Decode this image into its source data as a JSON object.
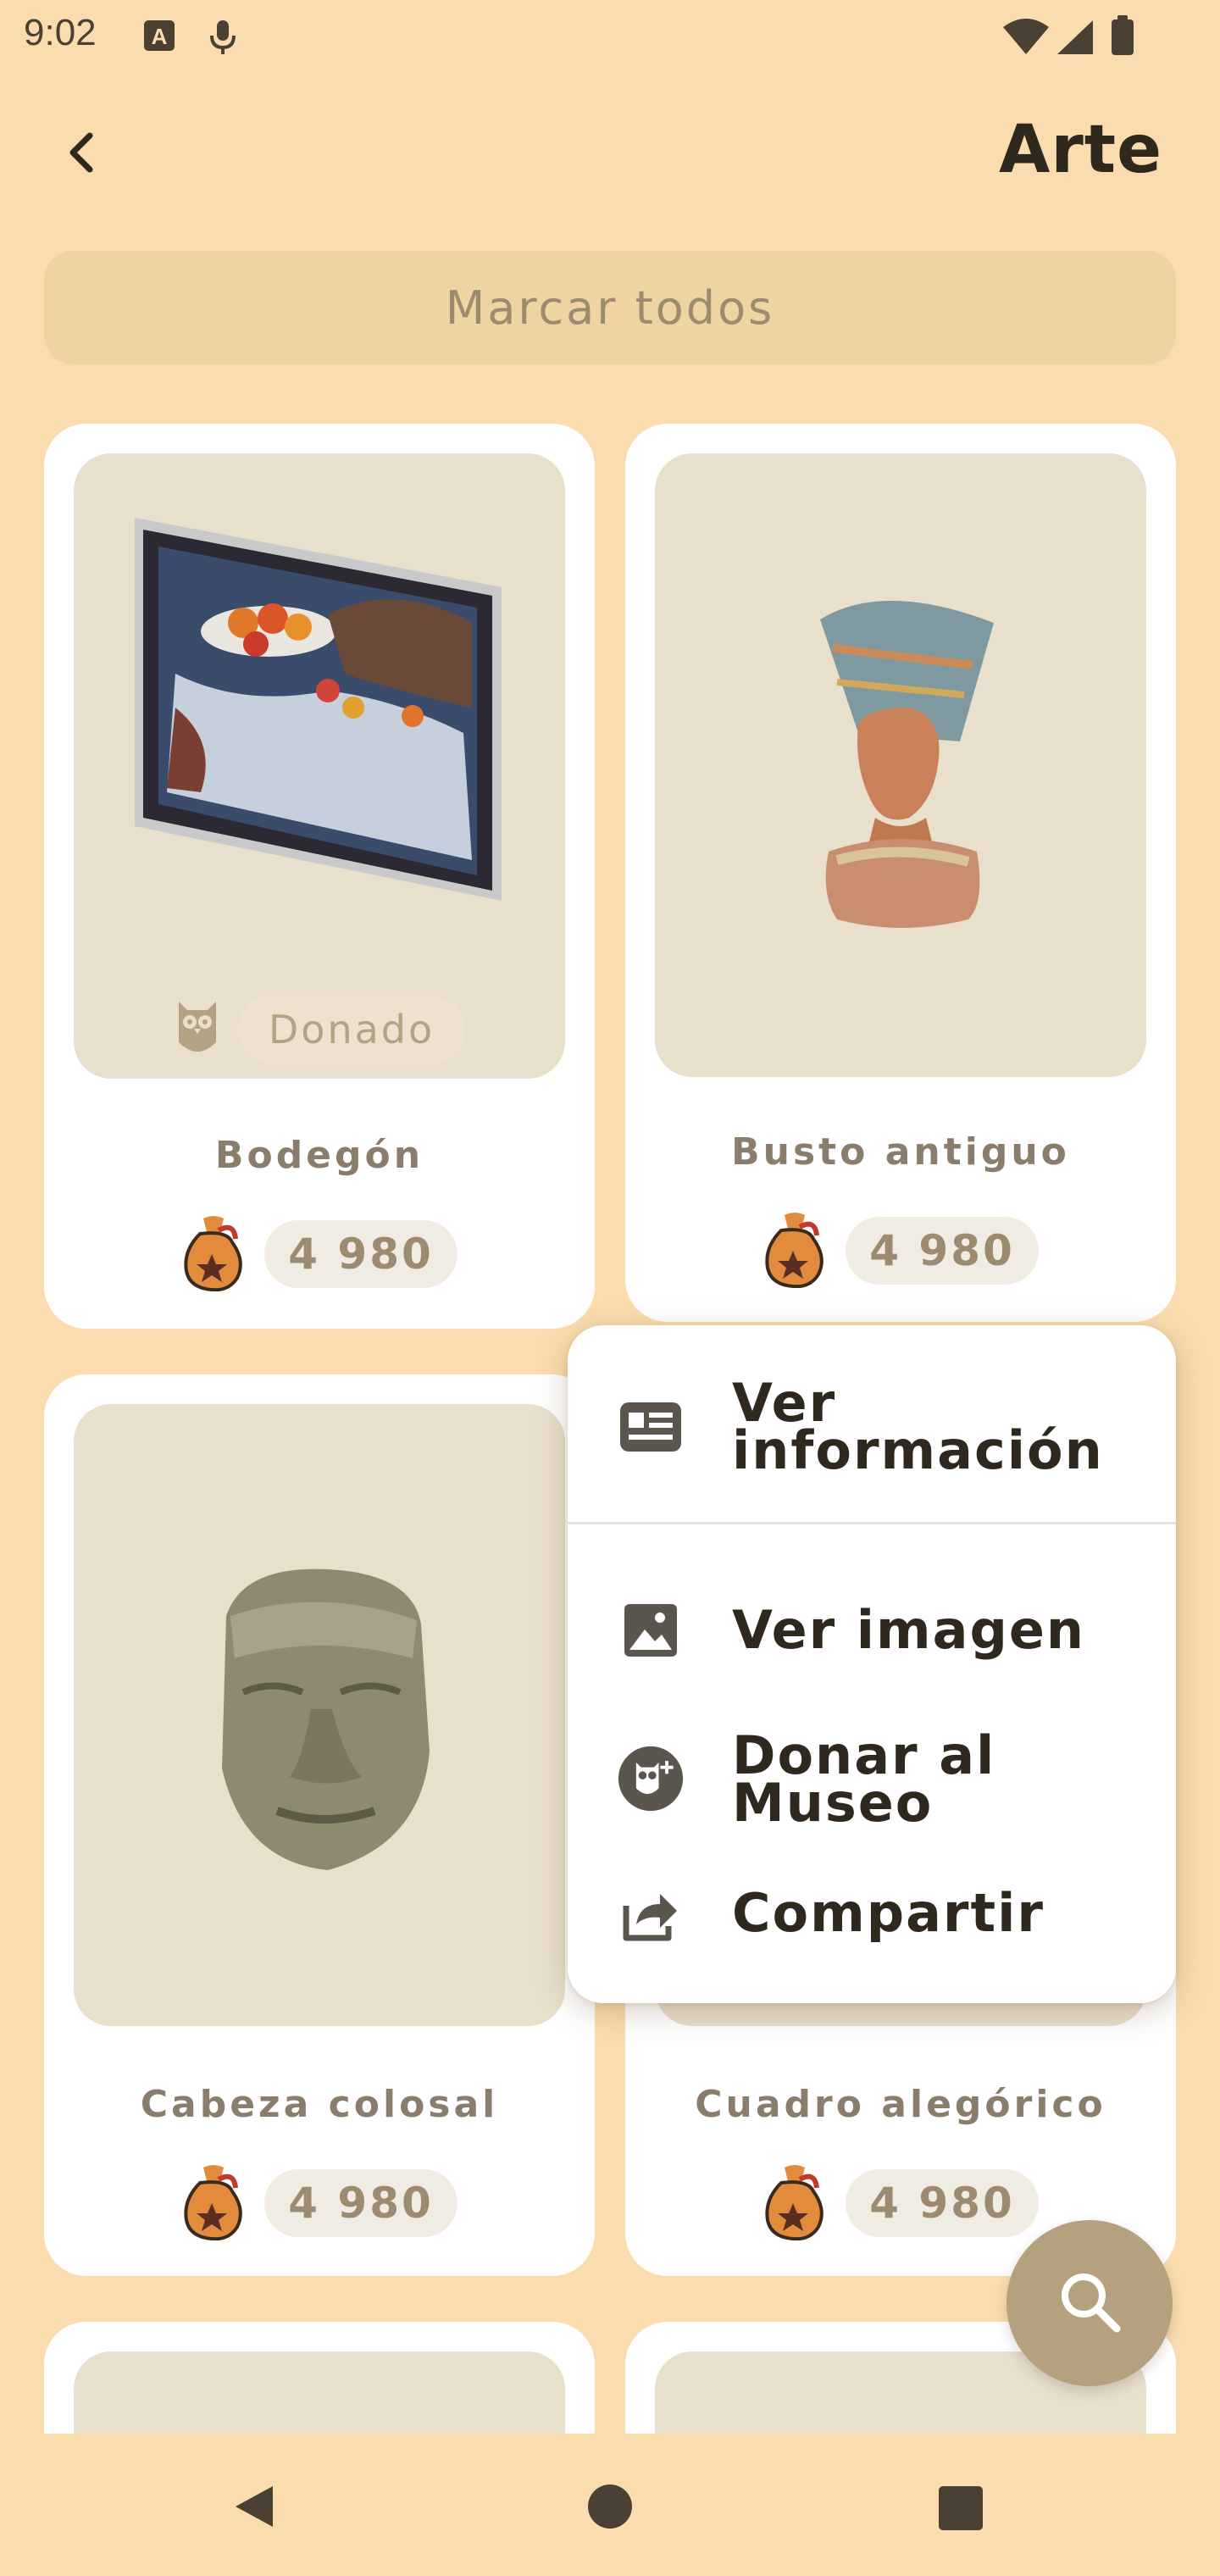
{
  "status_bar": {
    "time": "9:02"
  },
  "header": {
    "title": "Arte",
    "back_icon": "back-arrow-icon"
  },
  "actions": {
    "mark_all_label": "Marcar todos"
  },
  "items": [
    {
      "name": "Bodegón",
      "price": "4 980",
      "donated_label": "Donado",
      "image": "painting-still-life"
    },
    {
      "name": "Busto antiguo",
      "price": "4 980",
      "image": "bust-nefertiti"
    },
    {
      "name": "Cabeza colosal",
      "price": "4 980",
      "image": "olmec-head"
    },
    {
      "name": "Cuadro alegórico",
      "price": "4 980",
      "image": "allegorical-painting"
    }
  ],
  "context_menu": {
    "items": [
      {
        "label_line1": "Ver",
        "label_line2": "información",
        "icon": "info-card-icon"
      },
      {
        "label": "Ver imagen",
        "icon": "image-icon"
      },
      {
        "label_line1": "Donar al",
        "label_line2": "Museo",
        "icon": "owl-donate-icon"
      },
      {
        "label": "Compartir",
        "icon": "share-icon"
      }
    ]
  },
  "fab": {
    "icon": "search-icon"
  },
  "colors": {
    "background": "#fbdcaf",
    "card": "#ffffff",
    "image_bg": "#e8dfcd",
    "accent": "#b5a17d",
    "text_muted": "#8a7d6c"
  }
}
